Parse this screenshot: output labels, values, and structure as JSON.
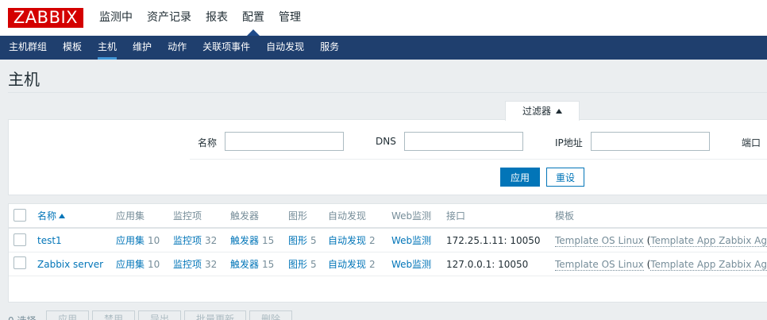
{
  "logo": {
    "text": "ZABBIX",
    "color": "#d40000"
  },
  "main_nav": [
    "监测中",
    "资产记录",
    "报表",
    "配置",
    "管理"
  ],
  "main_nav_active": "配置",
  "sub_nav": [
    "主机群组",
    "模板",
    "主机",
    "维护",
    "动作",
    "关联项事件",
    "自动发现",
    "服务"
  ],
  "sub_nav_active": "主机",
  "page_title": "主机",
  "filter": {
    "tab_label": "过滤器",
    "name_label": "名称",
    "name_value": "",
    "dns_label": "DNS",
    "dns_value": "",
    "ip_label": "IP地址",
    "ip_value": "",
    "port_label": "端口",
    "apply_label": "应用",
    "reset_label": "重设"
  },
  "table": {
    "headers": {
      "name": "名称",
      "applications": "应用集",
      "items": "监控项",
      "triggers": "触发器",
      "graphs": "图形",
      "discovery": "自动发现",
      "web": "Web监测",
      "interface": "接口",
      "templates": "模板"
    },
    "rows": [
      {
        "name": "test1",
        "applications_label": "应用集",
        "applications_count": "10",
        "items_label": "监控项",
        "items_count": "32",
        "triggers_label": "触发器",
        "triggers_count": "15",
        "graphs_label": "图形",
        "graphs_count": "5",
        "discovery_label": "自动发现",
        "discovery_count": "2",
        "web_label": "Web监测",
        "interface": "172.25.1.11: 10050",
        "template": "Template OS Linux",
        "template_parent": "Template App Zabbix Agent"
      },
      {
        "name": "Zabbix server",
        "applications_label": "应用集",
        "applications_count": "10",
        "items_label": "监控项",
        "items_count": "32",
        "triggers_label": "触发器",
        "triggers_count": "15",
        "graphs_label": "图形",
        "graphs_count": "5",
        "discovery_label": "自动发现",
        "discovery_count": "2",
        "web_label": "Web监测",
        "interface": "127.0.0.1: 10050",
        "template": "Template OS Linux",
        "template_parent": "Template App Zabbix Agent"
      }
    ]
  },
  "footer": {
    "selected": "0 选择",
    "buttons": [
      "应用",
      "禁用",
      "导出",
      "批量更新",
      "删除"
    ]
  }
}
